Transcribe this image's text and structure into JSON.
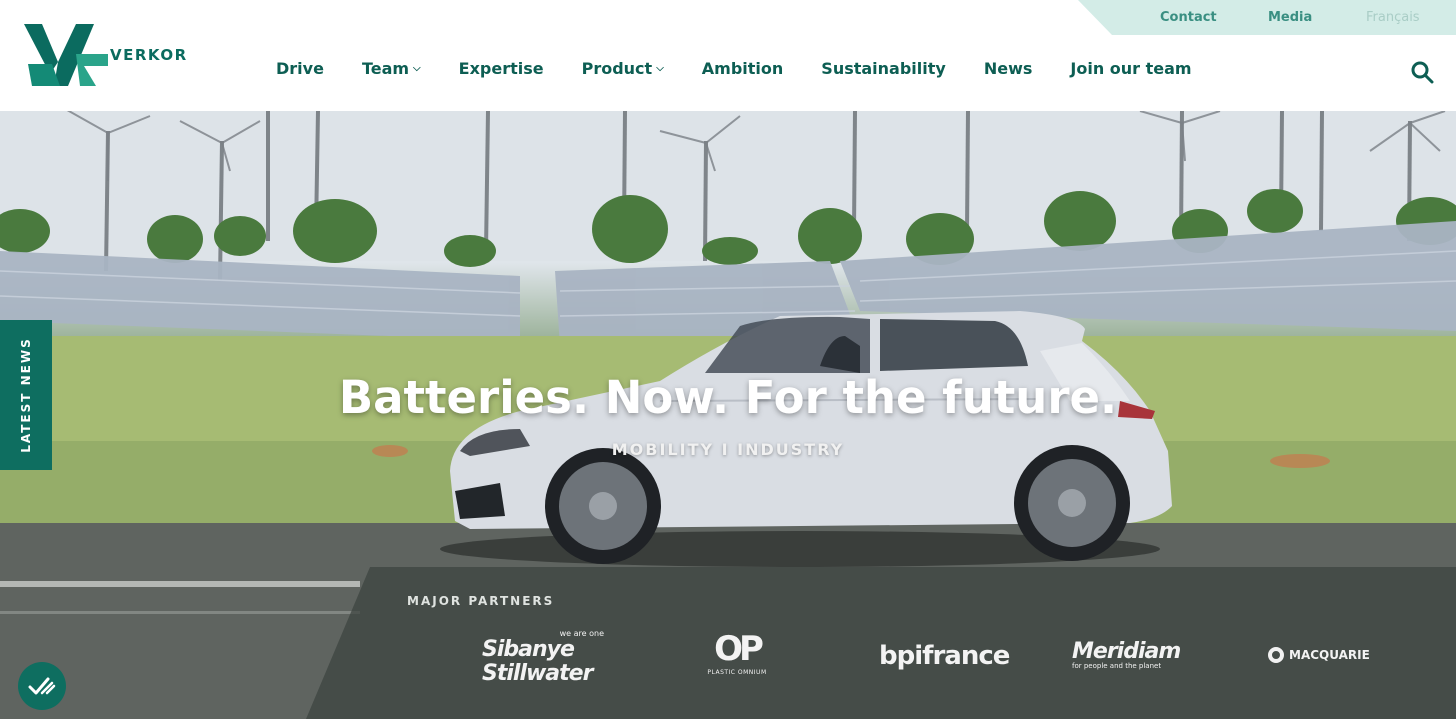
{
  "brand": {
    "name": "VERKOR",
    "color": "#0e6e60"
  },
  "topbar": {
    "contact": "Contact",
    "media": "Media",
    "language": "Français"
  },
  "nav": {
    "items": [
      {
        "label": "Drive",
        "dropdown": false
      },
      {
        "label": "Team",
        "dropdown": true
      },
      {
        "label": "Expertise",
        "dropdown": false
      },
      {
        "label": "Product",
        "dropdown": true
      },
      {
        "label": "Ambition",
        "dropdown": false
      },
      {
        "label": "Sustainability",
        "dropdown": false
      },
      {
        "label": "News",
        "dropdown": false
      },
      {
        "label": "Join our team",
        "dropdown": false
      }
    ],
    "search_icon": "search-icon"
  },
  "hero": {
    "title": "Batteries. Now. For the future.",
    "subtitle": "MOBILITY I INDUSTRY"
  },
  "side_tab": {
    "label": "LATEST NEWS"
  },
  "partners": {
    "title": "MAJOR PARTNERS",
    "sibanye": {
      "tagline": "we are one",
      "line1": "Sibanye",
      "line2": "Stillwater"
    },
    "op": {
      "mark": "OP",
      "caption": "PLASTIC OMNIUM"
    },
    "bpifrance": {
      "name": "bpifrance"
    },
    "meridiam": {
      "name": "Meridiam",
      "caption": "for people and the planet"
    },
    "macquarie": {
      "name": "MACQUARIE"
    }
  },
  "accessibility": {
    "icon": "accessibility-icon"
  }
}
